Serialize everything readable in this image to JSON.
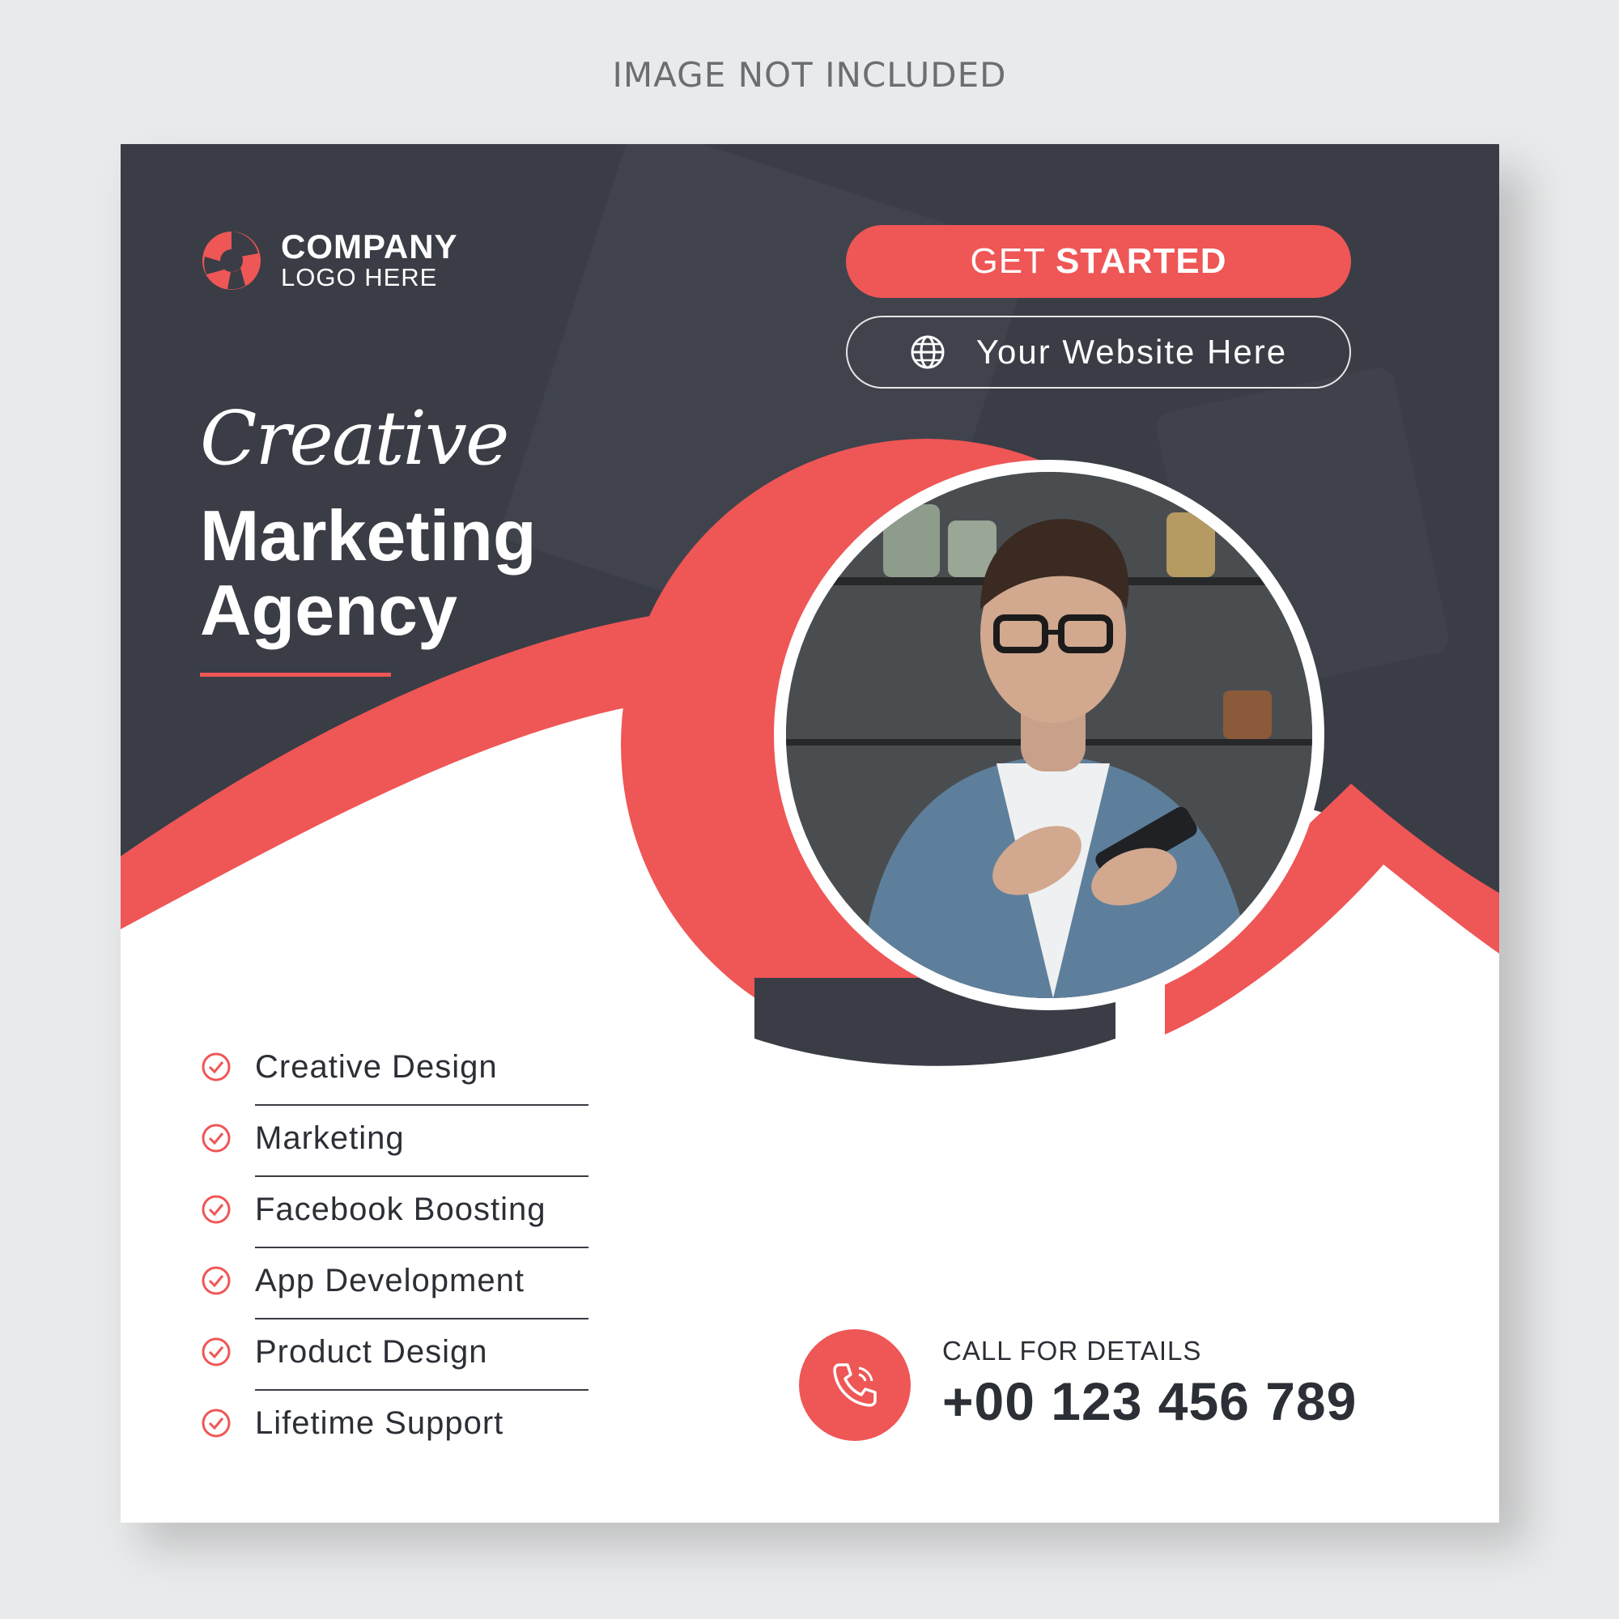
{
  "notice": "IMAGE NOT INCLUDED",
  "logo": {
    "line1": "COMPANY",
    "line2": "LOGO HERE",
    "icon": "logo-swirl-icon"
  },
  "cta": {
    "get_light": "GET",
    "get_bold": "STARTED",
    "website": "Your Website Here",
    "website_icon": "globe-icon"
  },
  "headline": {
    "script": "Creative",
    "line1": "Marketing",
    "line2": "Agency"
  },
  "services": [
    "Creative Design",
    "Marketing",
    "Facebook Boosting",
    "App Development",
    "Product Design",
    "Lifetime Support"
  ],
  "contact": {
    "label": "CALL FOR DETAILS",
    "phone": "+00 123 456 789",
    "icon": "phone-icon"
  },
  "colors": {
    "accent": "#ef5656",
    "dark": "#3a3d45",
    "text": "#2c2f36",
    "background": "#e9eaeb"
  }
}
